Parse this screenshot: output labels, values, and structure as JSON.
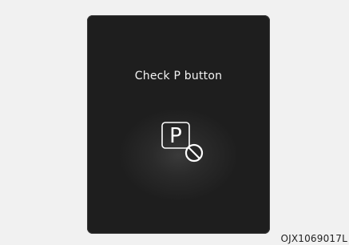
{
  "display": {
    "message": "Check P button",
    "icon": "p-button-prohibited-icon",
    "icon_letter": "P"
  },
  "figure_code": "OJX1069017L",
  "colors": {
    "page_background": "#f1f1f1",
    "display_background": "#1e1e1e",
    "text": "#f4f4f4",
    "icon": "#ffffff"
  }
}
